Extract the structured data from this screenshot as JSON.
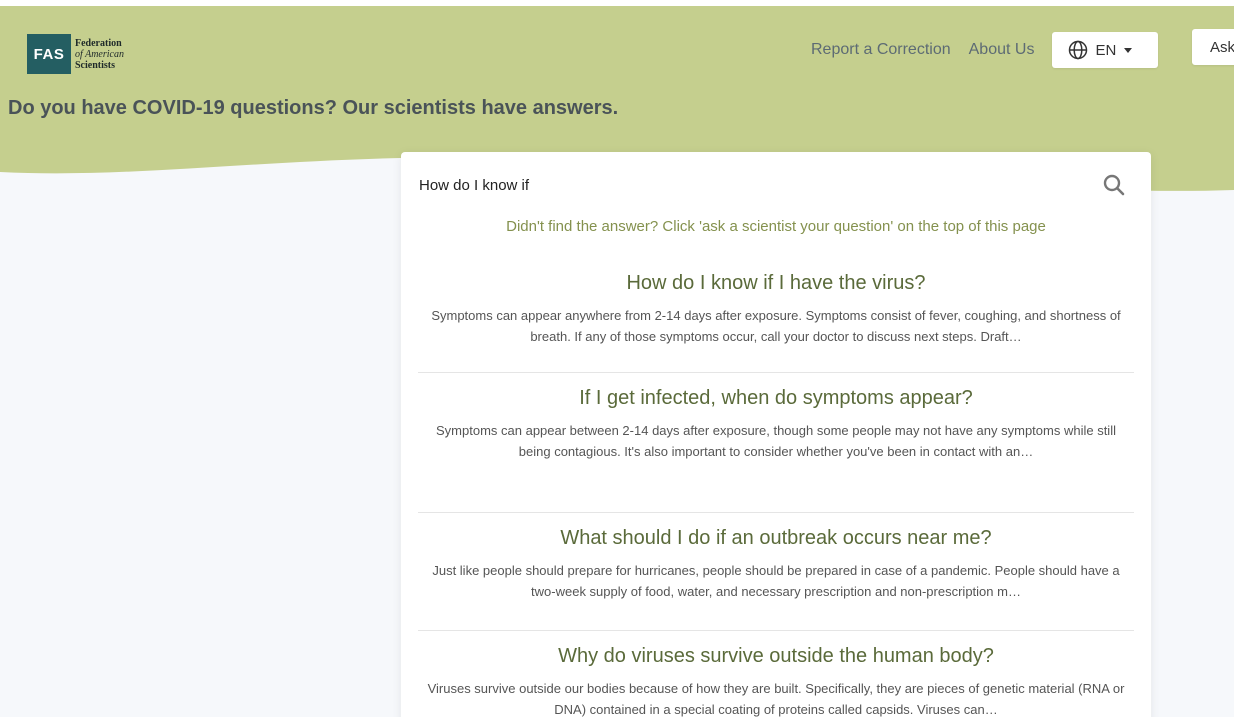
{
  "brand": {
    "logo_abbr": "FAS",
    "logo_line1": "Federation",
    "logo_line2": "of American",
    "logo_line3": "Scientists",
    "hero_color": "#c5cf8e"
  },
  "nav": {
    "report": "Report a Correction",
    "about": "About Us",
    "lang": "EN",
    "ask": "Ask"
  },
  "hero": {
    "title": "Do you have COVID-19 questions? Our scientists have answers."
  },
  "search": {
    "value": "How do I know if",
    "hint": "Didn't find the answer? Click 'ask a scientist your question' on the top of this page"
  },
  "results": [
    {
      "title": "How do I know if I have the virus?",
      "snippet": "Symptoms can appear anywhere from 2-14 days after exposure. Symptoms consist of fever, coughing, and shortness of breath. If any of those symptoms occur, call your doctor to discuss next steps. Draft…"
    },
    {
      "title": "If I get infected, when do symptoms appear?",
      "snippet": "Symptoms can appear between 2-14 days after exposure, though some people may not have any symptoms while still being contagious. It's also important to consider whether you've been in contact with an…"
    },
    {
      "title": "What should I do if an outbreak occurs near me?",
      "snippet": "Just like people should prepare for hurricanes, people should be prepared in case of a pandemic. People should have a two-week supply of food, water, and necessary prescription and non-prescription m…"
    },
    {
      "title": "Why do viruses survive outside the human body?",
      "snippet": "Viruses survive outside our bodies because of how they are built. Specifically, they are pieces of genetic material (RNA or DNA) contained in a special coating of proteins called capsids. Viruses can…"
    }
  ]
}
